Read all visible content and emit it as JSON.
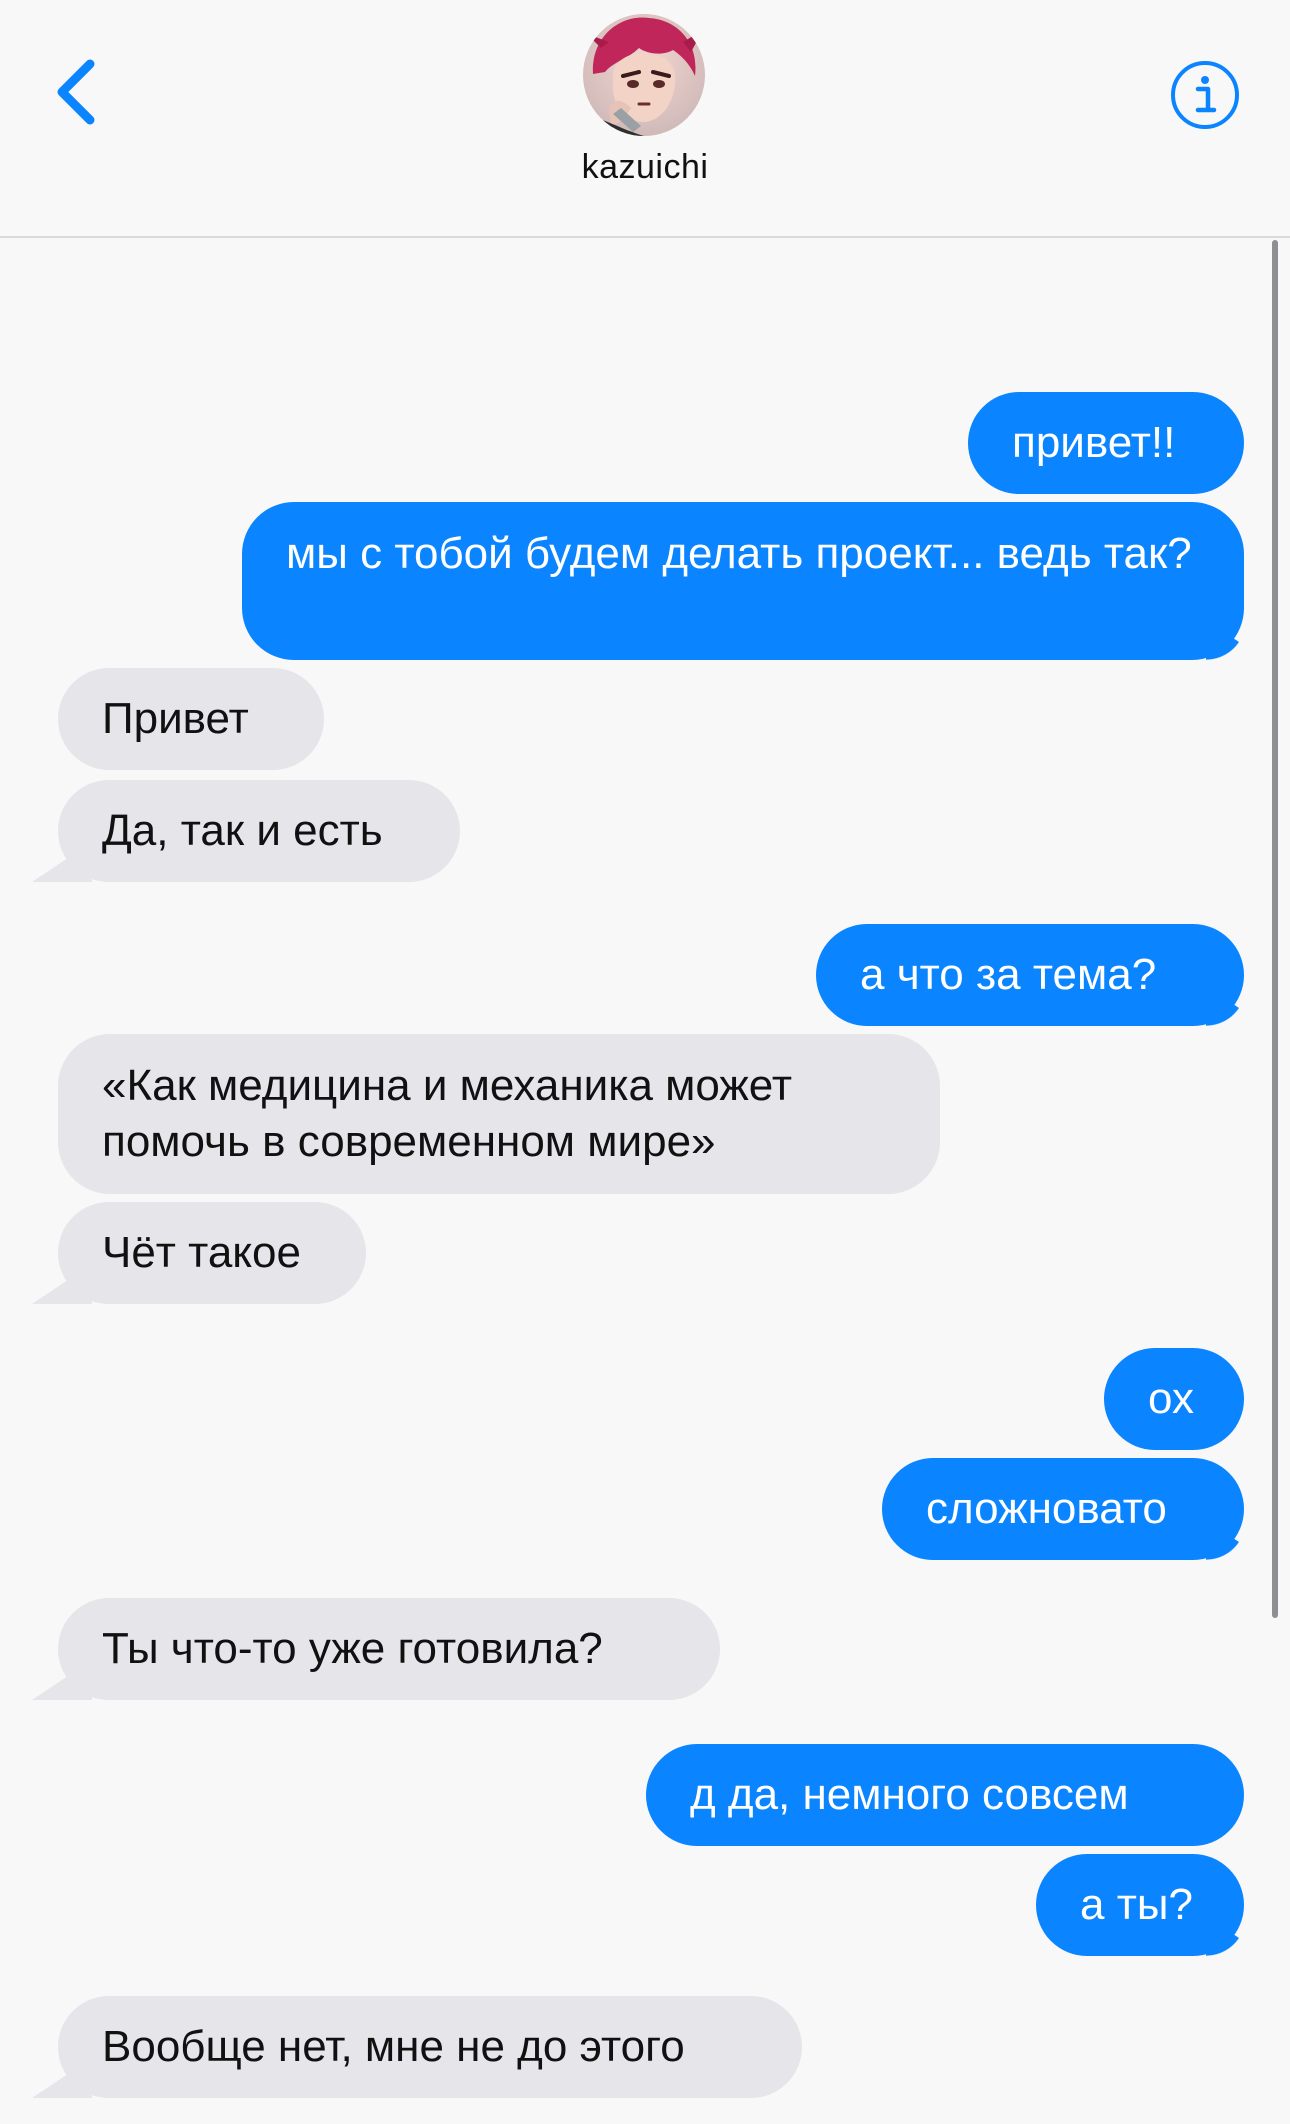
{
  "header": {
    "contact_name": "kazuichi",
    "back_icon": "chevron-left-icon",
    "info_icon": "info-circle-icon",
    "accent_color": "#0a84ff"
  },
  "messages": [
    {
      "direction": "outgoing",
      "text": "привет!!"
    },
    {
      "direction": "outgoing",
      "text": "мы с тобой будем делать проект... ведь так?"
    },
    {
      "direction": "incoming",
      "text": "Привет"
    },
    {
      "direction": "incoming",
      "text": "Да, так и есть"
    },
    {
      "direction": "outgoing",
      "text": "а что за тема?"
    },
    {
      "direction": "incoming",
      "text": "«Как медицина и механика может помочь в современном мире»"
    },
    {
      "direction": "incoming",
      "text": "Чёт такое"
    },
    {
      "direction": "outgoing",
      "text": "ох"
    },
    {
      "direction": "outgoing",
      "text": "сложновато"
    },
    {
      "direction": "incoming",
      "text": "Ты что-то уже готовила?"
    },
    {
      "direction": "outgoing",
      "text": "д да, немного совсем"
    },
    {
      "direction": "outgoing",
      "text": "а ты?"
    },
    {
      "direction": "incoming",
      "text": "Вообще нет, мне не до этого"
    }
  ],
  "colors": {
    "outgoing_bubble": "#0a84ff",
    "incoming_bubble": "#e5e5ea",
    "background": "#f8f8f8"
  }
}
